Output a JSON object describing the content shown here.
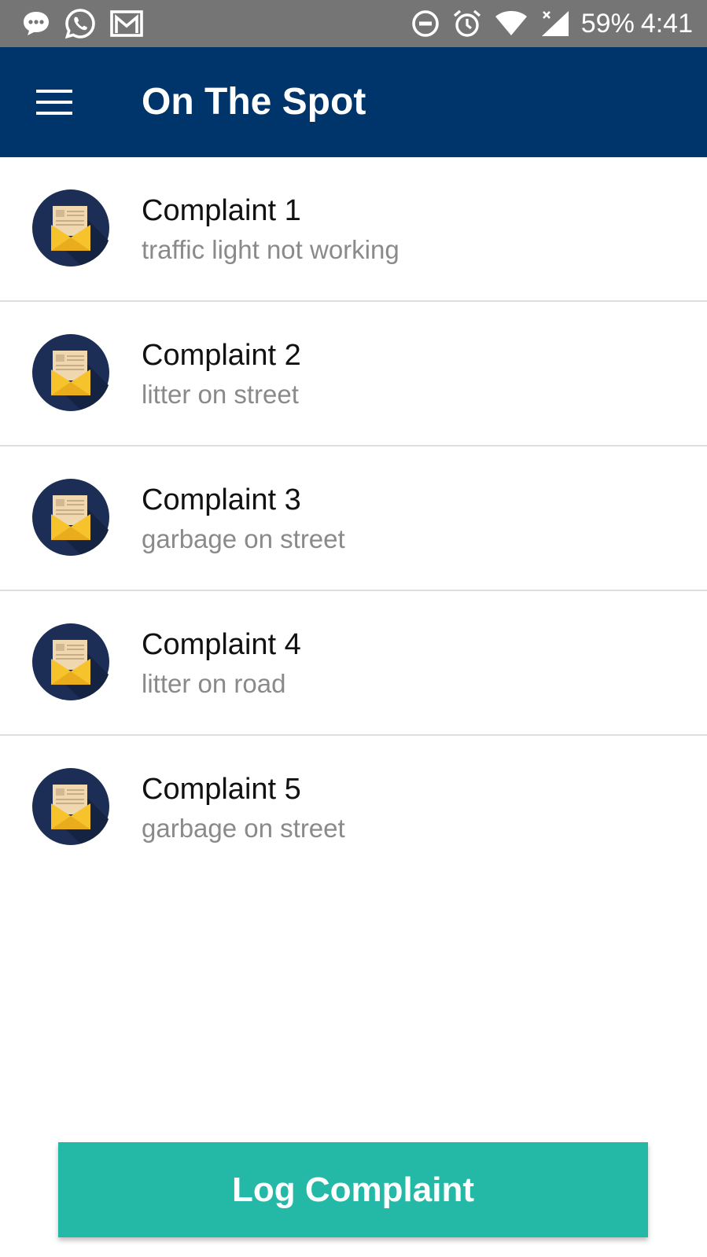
{
  "status_bar": {
    "battery": "59%",
    "time": "4:41",
    "left_icons": [
      "messages-icon",
      "whatsapp-icon",
      "gmail-icon"
    ],
    "right_icons": [
      "do-not-disturb-icon",
      "alarm-icon",
      "wifi-icon",
      "signal-icon"
    ]
  },
  "app_bar": {
    "title": "On The Spot",
    "color": "#00356b",
    "menu_icon": "hamburger-menu-icon"
  },
  "complaints": [
    {
      "title": "Complaint 1",
      "description": "traffic light not working",
      "icon": "envelope-letter-icon"
    },
    {
      "title": "Complaint 2",
      "description": "litter on street",
      "icon": "envelope-letter-icon"
    },
    {
      "title": "Complaint 3",
      "description": "garbage on street",
      "icon": "envelope-letter-icon"
    },
    {
      "title": "Complaint 4",
      "description": "litter on road",
      "icon": "envelope-letter-icon"
    },
    {
      "title": "Complaint 5",
      "description": "garbage on street",
      "icon": "envelope-letter-icon"
    }
  ],
  "log_button": {
    "label": "Log Complaint",
    "color": "#24b8a6"
  }
}
